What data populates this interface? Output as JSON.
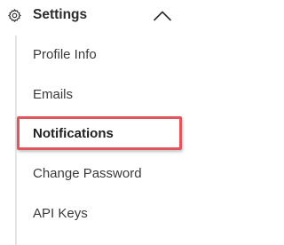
{
  "header": {
    "title": "Settings",
    "icon": "gear-icon",
    "expand_state_icon": "chevron-up-icon"
  },
  "menu": {
    "items": [
      {
        "label": "Profile Info",
        "active": false
      },
      {
        "label": "Emails",
        "active": false
      },
      {
        "label": "Notifications",
        "active": true
      },
      {
        "label": "Change Password",
        "active": false
      },
      {
        "label": "API Keys",
        "active": false
      }
    ]
  },
  "colors": {
    "text": "#2b2b2b",
    "rail": "#e4e4e4",
    "highlight_border": "#e0565d"
  }
}
